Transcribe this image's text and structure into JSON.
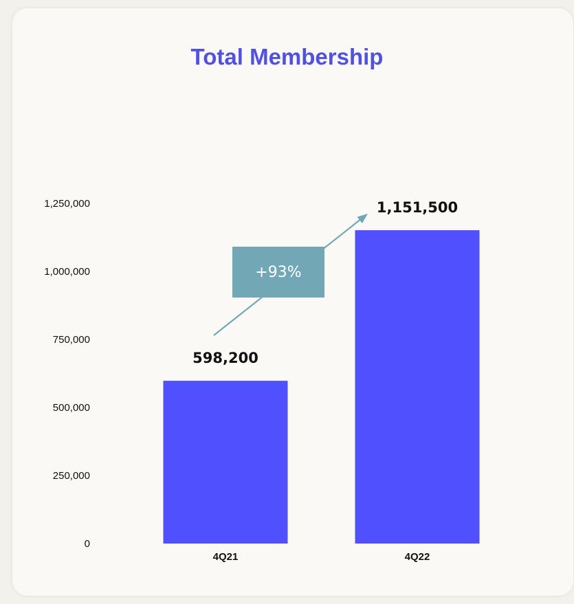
{
  "chart_data": {
    "type": "bar",
    "title": "Total Membership",
    "categories": [
      "4Q21",
      "4Q22"
    ],
    "values": [
      598200,
      1151500
    ],
    "value_labels": [
      "598,200",
      "1,151,500"
    ],
    "ylim": [
      0,
      1250000
    ],
    "yticks": [
      0,
      250000,
      500000,
      750000,
      1000000,
      1250000
    ],
    "ytick_labels": [
      "0",
      "250,000",
      "500,000",
      "750,000",
      "1,000,000",
      "1,250,000"
    ],
    "xlabel": "",
    "ylabel": "",
    "grid": false,
    "annotation": "+93%",
    "colors": {
      "bar": "#5050ff",
      "title": "#5050e8",
      "callout": "#72a7b5",
      "arrow": "#72a7b5"
    }
  }
}
